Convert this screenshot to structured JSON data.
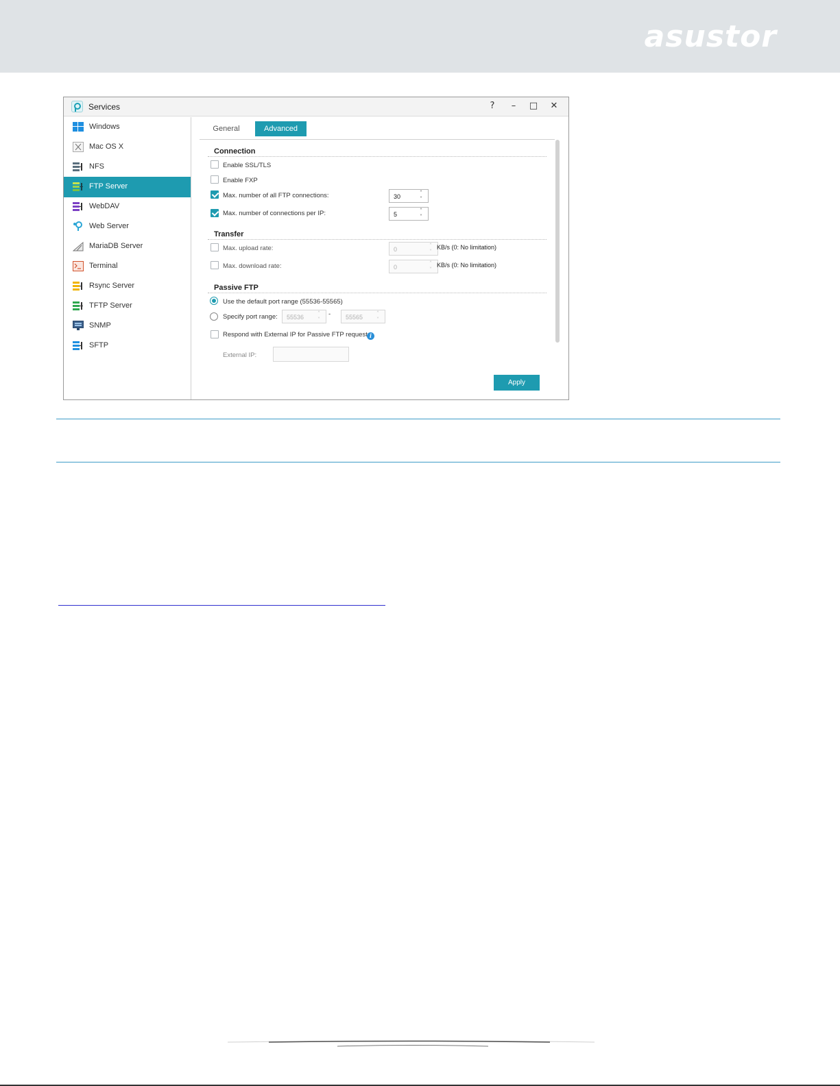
{
  "brand": {
    "logo_text": "asustor"
  },
  "window": {
    "title": "Services",
    "controls": {
      "help": "?",
      "minimize": "–",
      "maximize": "□",
      "close": "✕"
    }
  },
  "sidebar": {
    "items": [
      {
        "label": "Windows",
        "icon": "windows-icon"
      },
      {
        "label": "Mac OS X",
        "icon": "mac-icon"
      },
      {
        "label": "NFS",
        "icon": "nfs-icon"
      },
      {
        "label": "FTP Server",
        "icon": "ftp-server-icon",
        "active": true
      },
      {
        "label": "WebDAV",
        "icon": "webdav-icon"
      },
      {
        "label": "Web Server",
        "icon": "web-server-icon"
      },
      {
        "label": "MariaDB Server",
        "icon": "mariadb-icon"
      },
      {
        "label": "Terminal",
        "icon": "terminal-icon"
      },
      {
        "label": "Rsync Server",
        "icon": "rsync-icon"
      },
      {
        "label": "TFTP Server",
        "icon": "tftp-icon"
      },
      {
        "label": "SNMP",
        "icon": "snmp-icon"
      },
      {
        "label": "SFTP",
        "icon": "sftp-icon"
      }
    ]
  },
  "tabs": {
    "general": "General",
    "advanced": "Advanced",
    "active": "Advanced"
  },
  "connection": {
    "title": "Connection",
    "enable_ssl": {
      "label": "Enable SSL/TLS",
      "checked": false
    },
    "enable_fxp": {
      "label": "Enable FXP",
      "checked": false
    },
    "max_all": {
      "label": "Max. number of all FTP connections:",
      "checked": true,
      "value": "30"
    },
    "max_per_ip": {
      "label": "Max. number of connections per IP:",
      "checked": true,
      "value": "5"
    }
  },
  "transfer": {
    "title": "Transfer",
    "upload": {
      "label": "Max. upload rate:",
      "checked": false,
      "value": "0",
      "unit": "KB/s (0: No limitation)"
    },
    "download": {
      "label": "Max. download rate:",
      "checked": false,
      "value": "0",
      "unit": "KB/s (0: No limitation)"
    }
  },
  "passive": {
    "title": "Passive FTP",
    "default_range": {
      "label": "Use the default port range (55536-55565)",
      "selected": true
    },
    "specify_range": {
      "label": "Specify port range:",
      "selected": false,
      "from": "55536",
      "separator": "-",
      "to": "55565"
    },
    "external_ip_option": {
      "label": "Respond with External IP for Passive FTP request",
      "checked": false
    },
    "info_icon": "i",
    "external_ip": {
      "label": "External IP:",
      "value": ""
    }
  },
  "apply_label": "Apply",
  "colors": {
    "accent": "#1e9bb0",
    "header_band": "#dfe3e6",
    "rule": "#3d9cc7",
    "link": "#2f2fd0"
  }
}
